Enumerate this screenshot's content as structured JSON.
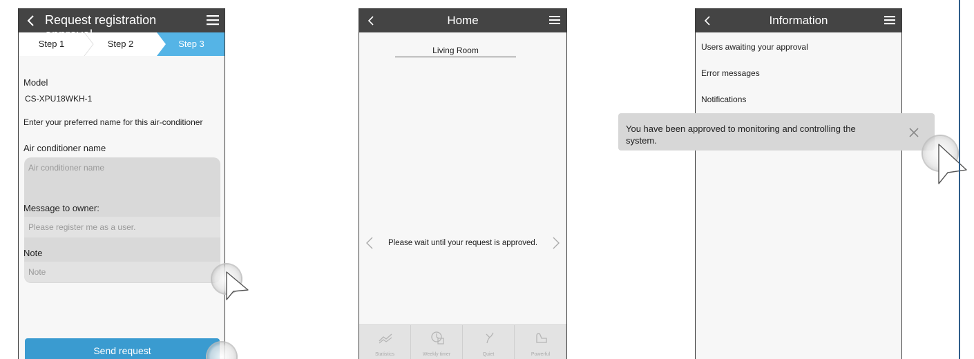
{
  "screen1": {
    "title": "Request registration approval",
    "steps": [
      "Step 1",
      "Step 2",
      "Step 3"
    ],
    "model_label": "Model",
    "model_value": "CS-XPU18WKH-1",
    "instruction": "Enter your preferred name for this air-conditioner",
    "name_label": "Air conditioner name",
    "name_placeholder": "Air conditioner name",
    "message_label": "Message to owner:",
    "message_value": "Please register me as a user.",
    "note_label": "Note",
    "note_placeholder": "Note",
    "send_button": "Send request"
  },
  "screen2": {
    "title": "Home",
    "room": "Living Room",
    "wait_message": "Please wait until your request is approved.",
    "bottom_tabs": [
      "Statistics",
      "Weekly timer",
      "Quiet",
      "Powerful"
    ]
  },
  "screen3": {
    "title": "Information",
    "items": [
      "Users awaiting your approval",
      "Error messages",
      "Notifications"
    ],
    "toast_message": "You have been approved to monitoring and controlling the system."
  },
  "colors": {
    "appbar": "#444444",
    "accent_blue": "#3a9bd0",
    "step_active": "#55b4e6"
  }
}
